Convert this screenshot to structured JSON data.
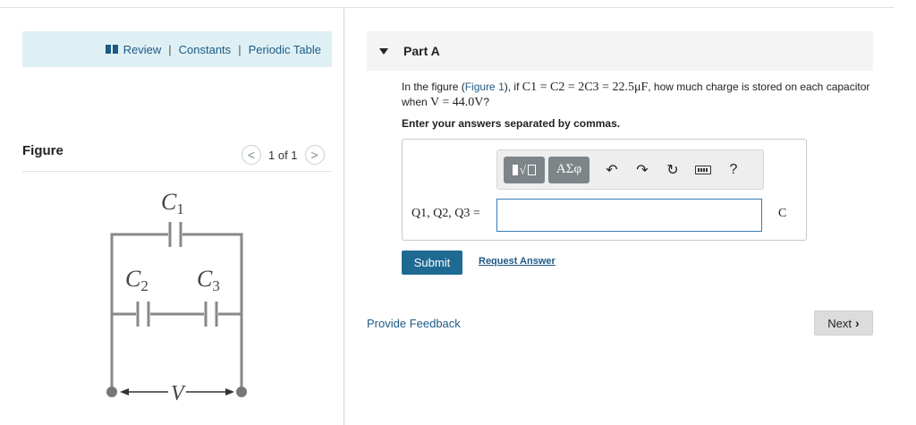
{
  "resources": {
    "review": "Review",
    "constants": "Constants",
    "periodic_table": "Periodic Table",
    "separator": "|"
  },
  "figure": {
    "title": "Figure",
    "prev": "<",
    "next": ">",
    "counter": "1 of 1",
    "labels": {
      "c1": "C",
      "c1_sub": "1",
      "c2": "C",
      "c2_sub": "2",
      "c3": "C",
      "c3_sub": "3",
      "v": "V"
    }
  },
  "part": {
    "title": "Part A",
    "question_intro": "In the figure (",
    "figure_link": "Figure 1",
    "question_mid": "), if ",
    "condition": "C1 = C2 = 2C3 = 22.5μF",
    "question_tail": ", how much charge is stored on each capacitor when ",
    "voltage": "V = 44.0V",
    "question_end": "?",
    "instruction": "Enter your answers separated by commas."
  },
  "answer": {
    "label": "Q1, Q2, Q3 =",
    "value": "",
    "unit": "C"
  },
  "toolbar": {
    "templates_icon": "templates-icon",
    "greek_label": "ΑΣφ",
    "undo_icon": "undo-icon",
    "redo_icon": "redo-icon",
    "reset_icon": "reset-icon",
    "keyboard_icon": "keyboard-icon",
    "help_label": "?"
  },
  "actions": {
    "submit": "Submit",
    "request_answer": "Request Answer",
    "feedback": "Provide Feedback",
    "next": "Next"
  },
  "colors": {
    "resource_bg": "#dff0f5",
    "link": "#1d5a86",
    "submit_bg": "#1e6a92",
    "toolbar_dark": "#7e8589"
  }
}
